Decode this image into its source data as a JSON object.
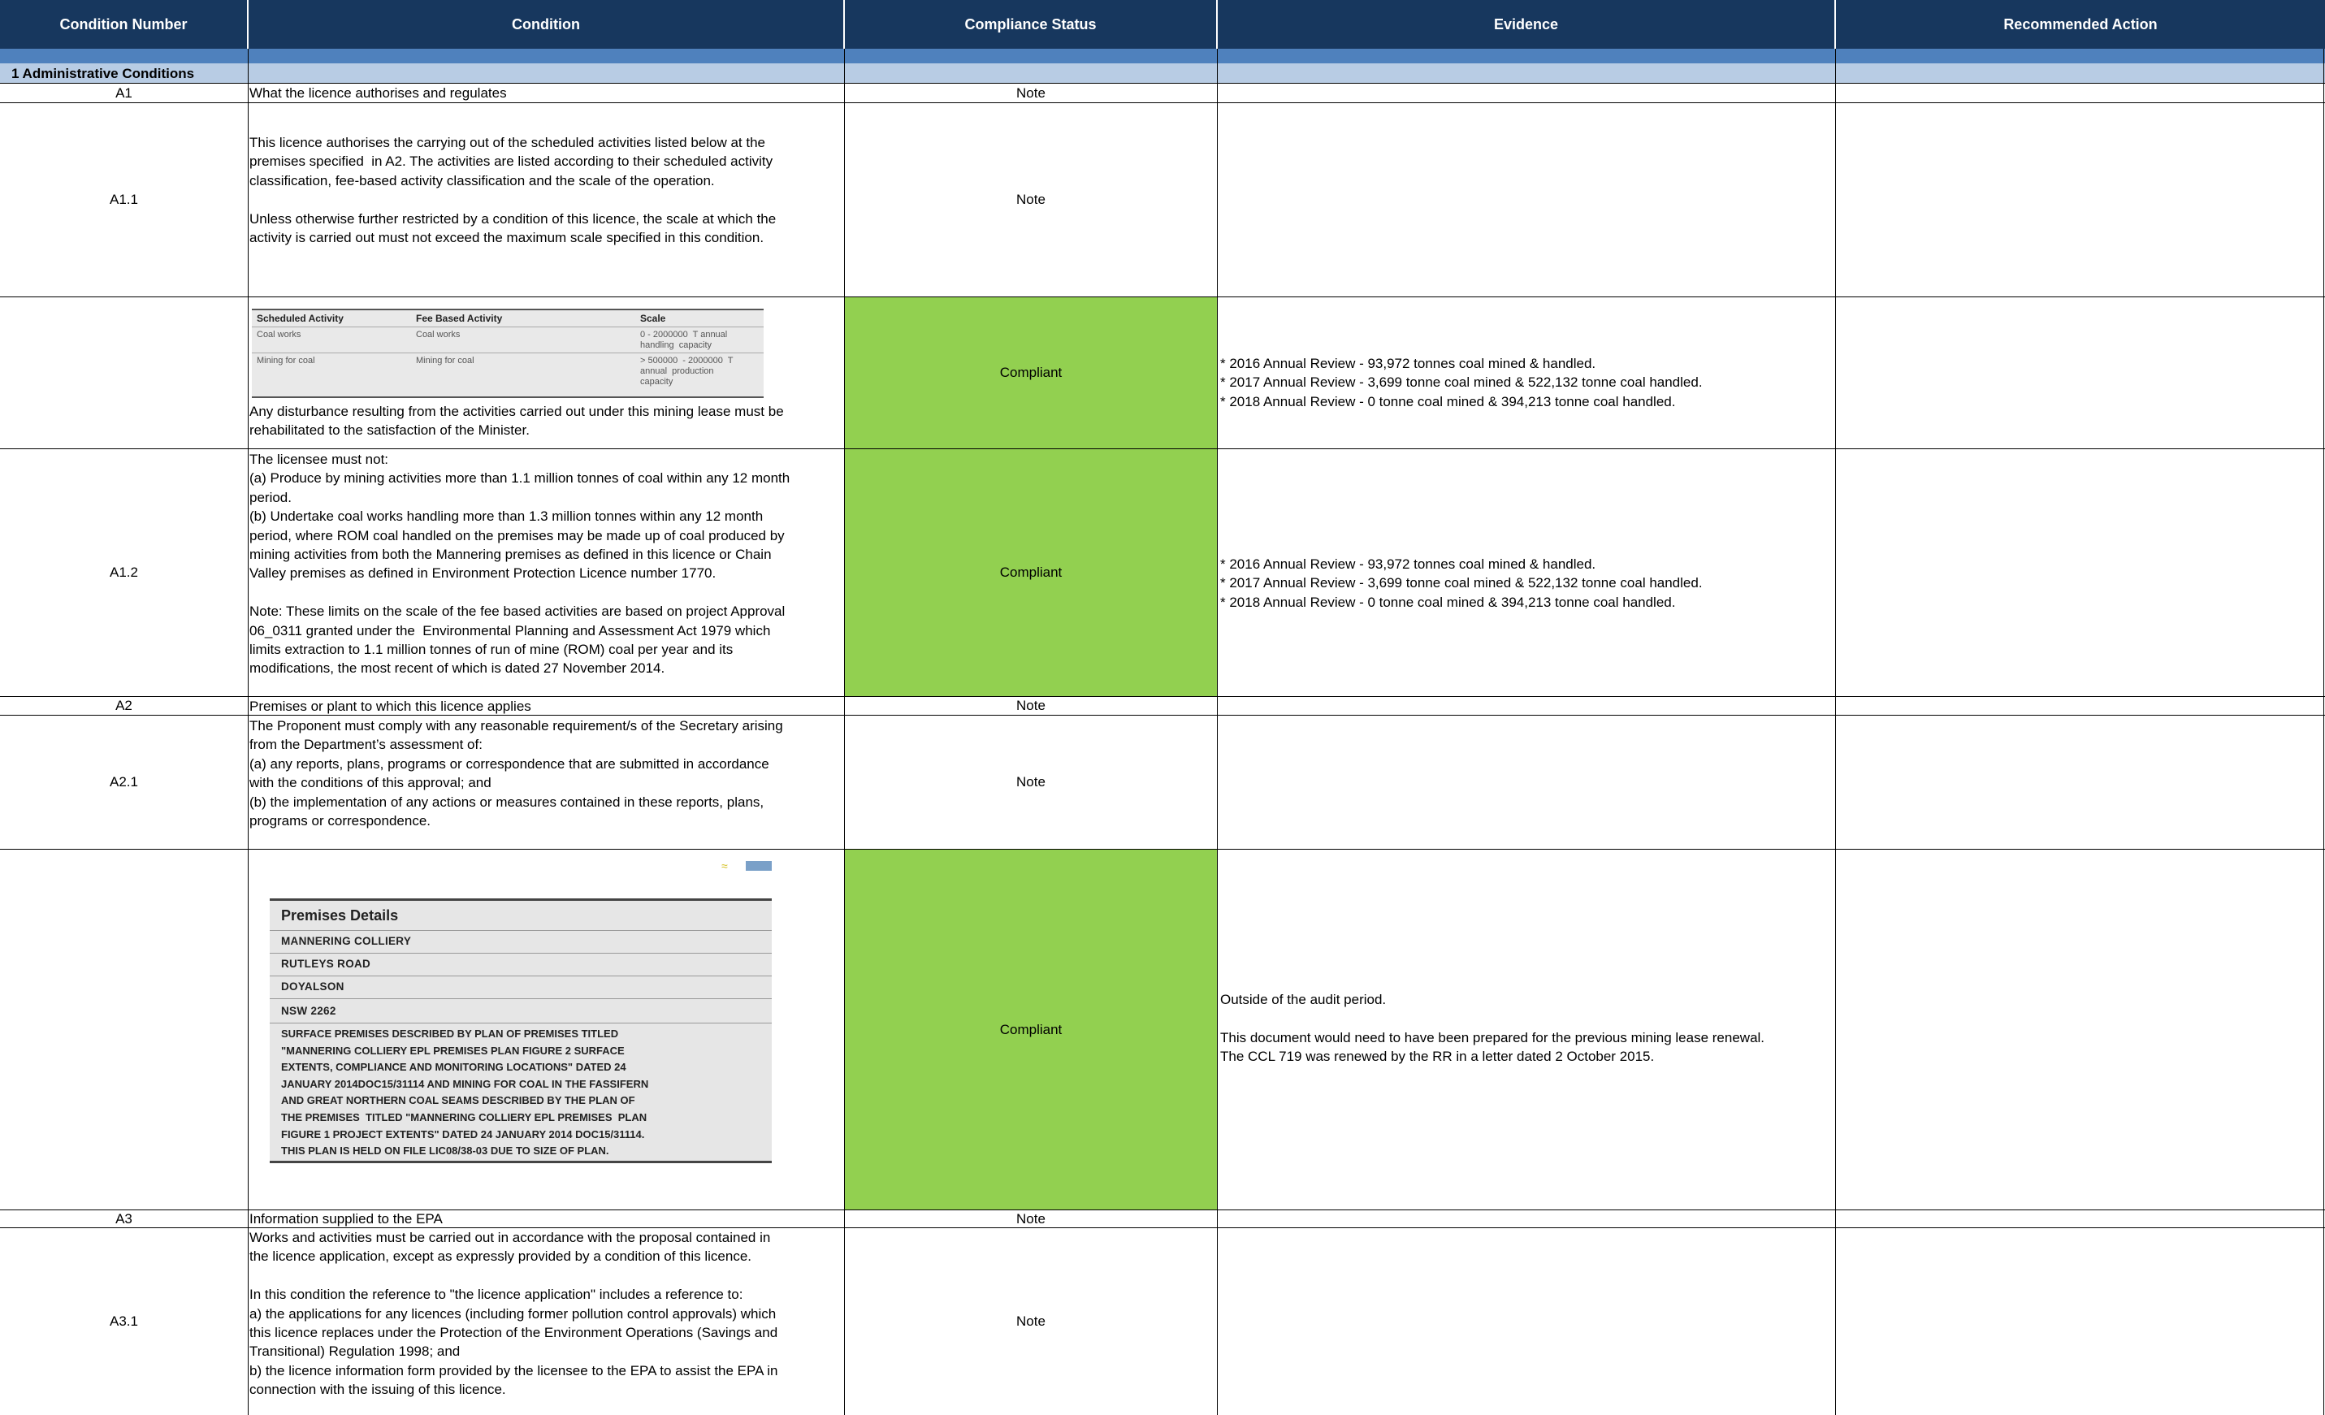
{
  "headers": {
    "condition_number": "Condition Number",
    "condition": "Condition",
    "compliance_status": "Compliance Status",
    "evidence": "Evidence",
    "recommended_action": "Recommended Action"
  },
  "section_title": "1 Administrative Conditions",
  "rows": {
    "a1": {
      "num": "A1",
      "condition": "What the licence authorises and regulates",
      "status": "Note"
    },
    "a1_1": {
      "num": "A1.1",
      "condition": "This licence authorises the carrying out of the scheduled activities listed below at the\npremises specified  in A2. The activities are listed according to their scheduled activity\nclassification, fee-based activity classification and the scale of the operation.\n\nUnless otherwise further restricted by a condition of this licence, the scale at which the\nactivity is carried out must not exceed the maximum scale specified in this condition.",
      "status": "Note"
    },
    "a1_1b": {
      "condition": "Any disturbance resulting from the activities carried out under this mining lease must be\nrehabilitated to the satisfaction of the Minister.",
      "status": "Compliant",
      "evidence": "* 2016 Annual Review - 93,972 tonnes coal mined & handled.\n* 2017 Annual Review - 3,699 tonne coal mined & 522,132 tonne coal handled.\n* 2018 Annual Review - 0 tonne coal mined & 394,213 tonne coal handled."
    },
    "a1_2": {
      "num": "A1.2",
      "condition": "The licensee must not:\n(a) Produce by mining activities more than 1.1 million tonnes of coal within any 12 month\nperiod.\n(b) Undertake coal works handling more than 1.3 million tonnes within any 12 month\nperiod, where ROM coal handled on the premises may be made up of coal produced by\nmining activities from both the Mannering premises as defined in this licence or Chain\nValley premises as defined in Environment Protection Licence number 1770.\n\nNote: These limits on the scale of the fee based activities are based on project Approval\n06_0311 granted under the  Environmental Planning and Assessment Act 1979 which\nlimits extraction to 1.1 million tonnes of run of mine (ROM) coal per year and its\nmodifications, the most recent of which is dated 27 November 2014.",
      "status": "Compliant",
      "evidence": "* 2016 Annual Review - 93,972 tonnes coal mined & handled.\n* 2017 Annual Review - 3,699 tonne coal mined & 522,132 tonne coal handled.\n* 2018 Annual Review - 0 tonne coal mined & 394,213 tonne coal handled."
    },
    "a2": {
      "num": "A2",
      "condition": "Premises or plant to which this licence applies",
      "status": "Note"
    },
    "a2_1": {
      "num": "A2.1",
      "condition": "The Proponent must comply with any reasonable requirement/s of the Secretary arising\nfrom the Department’s assessment of:\n(a) any reports, plans, programs or correspondence that are submitted in accordance\nwith the conditions of this approval; and\n(b) the implementation of any actions or measures contained in these reports, plans,\nprograms or correspondence.",
      "status": "Note"
    },
    "a2_1b": {
      "status": "Compliant",
      "evidence": "Outside of the audit period.\n\nThis document would need to have been prepared for the previous mining lease renewal.\nThe CCL 719 was renewed by the RR in a letter dated 2 October 2015."
    },
    "a3": {
      "num": "A3",
      "condition": "Information supplied to the EPA",
      "status": "Note"
    },
    "a3_1": {
      "num": "A3.1",
      "condition": "Works and activities must be carried out in accordance with the proposal contained in\nthe licence application, except as expressly provided by a condition of this licence.\n\nIn this condition the reference to \"the licence application\" includes a reference to:\na) the applications for any licences (including former pollution control approvals) which\nthis licence replaces under the Protection of the Environment Operations (Savings and\nTransitional) Regulation 1998; and\nb) the licence information form provided by the licensee to the EPA to assist the EPA in\nconnection with the issuing of this licence.",
      "status": "Note"
    }
  },
  "activity_table": {
    "headers": [
      "Scheduled Activity",
      "Fee Based Activity",
      "Scale"
    ],
    "rows": [
      [
        "Coal works",
        "Coal works",
        "0 - 2000000  T annual\nhandling  capacity"
      ],
      [
        "Mining  for coal",
        "Mining  for coal",
        "> 500000  - 2000000  T\nannual  production\ncapacity"
      ]
    ]
  },
  "premises_details": {
    "title": "Premises Details",
    "lines": [
      "MANNERING COLLIERY",
      "RUTLEYS ROAD",
      "DOYALSON",
      "NSW 2262"
    ],
    "description": "SURFACE PREMISES DESCRIBED BY PLAN OF PREMISES TITLED\n\"MANNERING COLLIERY EPL PREMISES PLAN FIGURE 2 SURFACE\nEXTENTS, COMPLIANCE AND MONITORING LOCATIONS\" DATED 24\nJANUARY 2014DOC15/31114 AND MINING FOR COAL IN THE FASSIFERN\nAND GREAT NORTHERN COAL SEAMS DESCRIBED BY THE PLAN OF\nTHE PREMISES  TITLED \"MANNERING COLLIERY EPL PREMISES  PLAN\nFIGURE 1 PROJECT EXTENTS\" DATED 24 JANUARY 2014 DOC15/31114.\nTHIS PLAN IS HELD ON FILE LIC08/38-03 DUE TO SIZE OF PLAN."
  },
  "colors": {
    "header_bg": "#17375e",
    "band": "#4f81bd",
    "section_bg": "#b8cce4",
    "compliant": "#92d050"
  }
}
